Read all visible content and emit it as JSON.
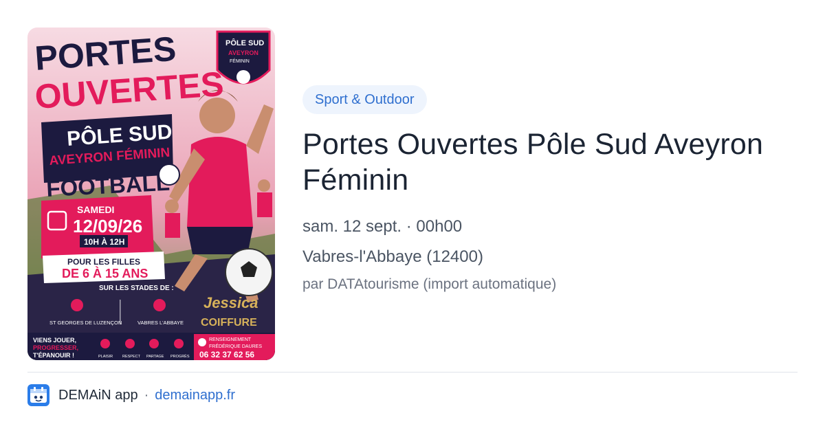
{
  "poster": {
    "title_line1": "PORTES",
    "title_line2": "OUVERTES",
    "club_line1": "PÔLE SUD",
    "club_line2": "AVEYRON FÉMININ",
    "sport": "FOOTBALL",
    "day": "SAMEDI",
    "date": "12/09/26",
    "hours": "10H À 12H",
    "audience_line1": "POUR LES FILLES",
    "audience_line2": "DE 6 À 15 ANS",
    "stadiums_label": "SUR LES STADES DE :",
    "stadium_1": "ST GEORGES DE LUZENÇON",
    "stadium_2": "VABRES L'ABBAYE",
    "badge_line1": "PÔLE SUD",
    "badge_line2": "AVEYRON",
    "badge_line3": "FÉMININ",
    "sponsor_name": "Jessica",
    "sponsor_brand": "COIFFURE",
    "slogan_line1": "VIENS JOUER,",
    "slogan_line2": "PROGRESSER,",
    "slogan_line3": "T'ÉPANOUIR !",
    "values": [
      "PLAISIR",
      "RESPECT",
      "PARTAGE",
      "PROGRÈS"
    ],
    "contact_label": "RENSEIGNEMENT",
    "contact_name": "FRÉDÉRIQUE DAURES",
    "contact_phone": "06 32 37 62 56"
  },
  "category": "Sport & Outdoor",
  "event_title": "Portes Ouvertes Pôle Sud Aveyron Féminin",
  "datetime": "sam. 12 sept. · 00h00",
  "location": "Vabres-l'Abbaye (12400)",
  "source": "par DATAtourisme (import automatique)",
  "footer": {
    "app_name": "DEMAiN app",
    "separator": "·",
    "domain": "demainapp.fr"
  },
  "colors": {
    "accent": "#2f6fcf",
    "poster_pink": "#e31b5b",
    "poster_navy": "#1c1a3f"
  }
}
